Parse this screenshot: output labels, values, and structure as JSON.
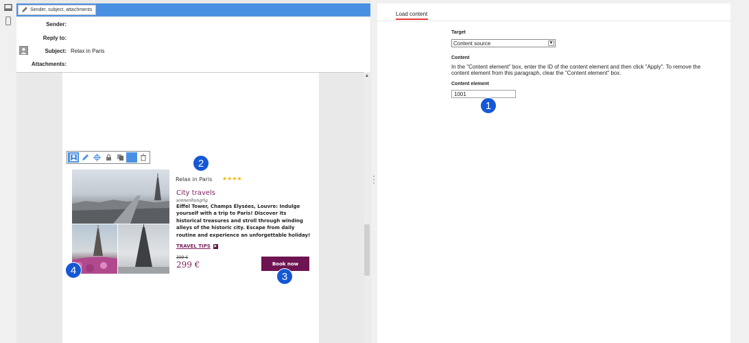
{
  "toolbar": {
    "edit_label": "Sender, subject, attachments"
  },
  "header": {
    "sender_label": "Sender:",
    "sender_value": "",
    "reply_label": "Reply to:",
    "reply_value": "",
    "subject_label": "Subject:",
    "subject_value": "Relax in Paris",
    "attachments_label": "Attachments:"
  },
  "teaser": {
    "category": "Relax in Paris",
    "stars": "★★★★",
    "title": "City travels",
    "subtitle": "sonnenhungrig",
    "body": "Eiffel Tower, Champs Élysées, Louvre: Indulge yourself with a trip to Paris! Discover its historical treasures and stroll through winding alleys of the historic city. Escape from daily routine and experience an unforgettable holiday!",
    "tips_label": "TRAVEL TIPS",
    "old_price": "399 €",
    "price": "299 €",
    "book_label": "Book now"
  },
  "callouts": [
    "1",
    "2",
    "3",
    "4"
  ],
  "right": {
    "tab_label": "Load content",
    "target_label": "Target",
    "target_value": "Content source",
    "content_label": "Content",
    "content_desc": "In the \"Content element\" box, enter the ID of the content element and then click \"Apply\". To remove the content element from this paragraph, clear the \"Content element\" box.",
    "element_label": "Content element",
    "element_value": "1001"
  },
  "colors": {
    "accent": "#4a90e2",
    "brand": "#7a1e5b",
    "button": "#6e1452",
    "callout": "#1558d6",
    "tab_underline": "#e53935"
  },
  "icons": [
    "desktop-icon",
    "mobile-icon",
    "pencil-icon",
    "avatar-icon",
    "person-icon",
    "edit-icon",
    "target-icon",
    "lock-icon",
    "copy-icon",
    "color-icon",
    "trash-icon",
    "chevron-down-icon",
    "arrow-right-icon",
    "scroll-up-icon"
  ]
}
